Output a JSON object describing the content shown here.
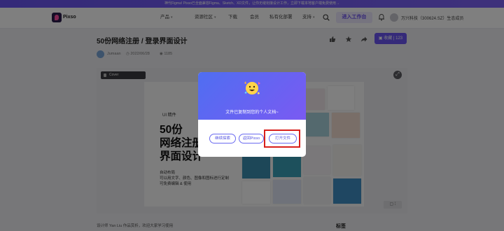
{
  "banner": {
    "text": "神代Figma! Pixso已全面兼容Figma、Sketch、XD文件，让你无缝衔接设计工作，立即下载本地客户端免费使用→"
  },
  "nav": {
    "brand": "Pixso",
    "items": [
      {
        "label": "产品",
        "has_caret": true
      },
      {
        "label": "资源社区",
        "has_caret": true
      },
      {
        "label": "下载",
        "has_caret": false
      },
      {
        "label": "会员",
        "has_caret": false
      },
      {
        "label": "私有化部署",
        "has_caret": false
      },
      {
        "label": "支持",
        "has_caret": true
      }
    ],
    "enter_workspace": "进入工作台",
    "user_name": "万兴科技（300624.SZ）生态成员"
  },
  "article": {
    "title": "50份网络注册 / 登录界面设计",
    "author": "Jumaan",
    "date": "2022/06/28",
    "views": "1185",
    "collect_label": "收藏",
    "collect_count": "123"
  },
  "preview": {
    "cover_label": "Cover",
    "ui_tag": "UI 精件",
    "headline": "50份\n网络注册\n界面设计",
    "description": "自动布局\n可以用文字、颜色、图像和图标进行定制\n可免费编辑 & 使用"
  },
  "caption": "设计师 Yan Liu 作品赏析，欢迎大家学习使用",
  "tags_heading": "标签",
  "modal": {
    "title": "文件已复制到您的个人文档~",
    "buttons": {
      "continue": "继续探索",
      "back": "返回Pixso",
      "open": "打开文件"
    }
  },
  "colors": {
    "brand": "#6a55f2",
    "highlight": "#d8201c",
    "overlay": "rgba(0,0,0,0.5)"
  }
}
